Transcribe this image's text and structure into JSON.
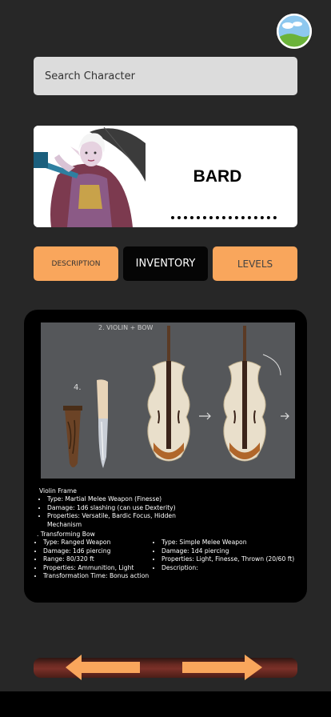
{
  "search": {
    "placeholder": "Search Character"
  },
  "character": {
    "class_name": "BARD"
  },
  "tabs": [
    {
      "label": "DESCRIPTION"
    },
    {
      "label": "INVENTORY"
    },
    {
      "label": "LEVELS"
    }
  ],
  "concept_art": {
    "caption": "2. VIOLIN + BOW",
    "number": "4."
  },
  "item_details": {
    "violin": {
      "title": "Violin Frame",
      "lines": [
        "Type: Martial Melee Weapon (Finesse)",
        "Damage: 1d6 slashing (can use Dexterity)",
        "Properties: Versatile, Bardic Focus, Hidden Mechanism"
      ]
    },
    "bow": {
      "title": ". Transforming Bow",
      "lines": [
        "Type: Ranged Weapon",
        "Damage: 1d6 piercing",
        "Range: 80/320 ft",
        "Properties: Ammunition, Light",
        "Transformation Time: Bonus action"
      ]
    },
    "dagger": {
      "lines": [
        "Type: Simple Melee Weapon",
        "Damage: 1d4 piercing",
        "Properties: Light, Finesse, Thrown (20/60 ft)",
        "Description:"
      ]
    }
  },
  "colors": {
    "background": "#272727",
    "accent": "#f9a65c",
    "panel": "#000000",
    "nav_bar": "#6a2a22",
    "arrow": "#f9a65c"
  },
  "icons": {
    "avatar": "landscape-icon",
    "prev": "arrow-left-icon",
    "next": "arrow-right-icon"
  }
}
